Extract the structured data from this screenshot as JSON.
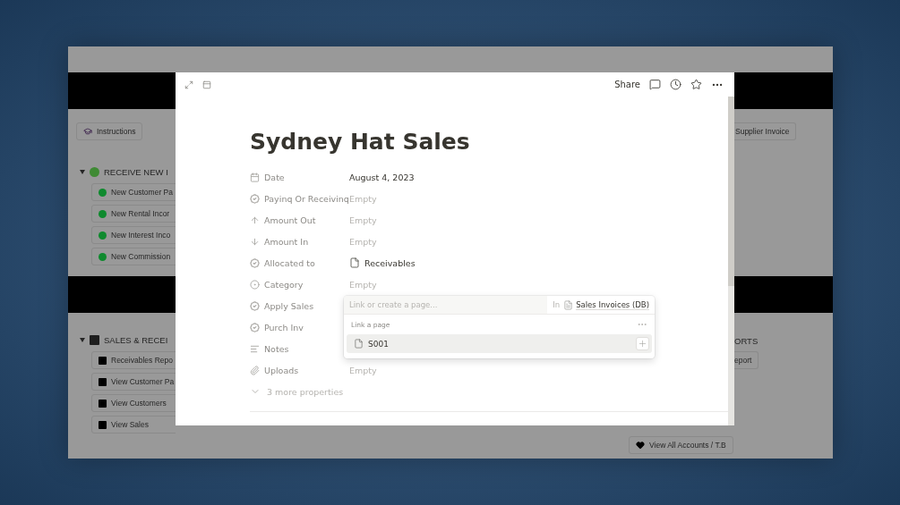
{
  "background": {
    "instructions_button": "Instructions",
    "left_sections": [
      {
        "title": "RECEIVE NEW I",
        "color": "#3f8a34",
        "buttons": [
          {
            "label": "New Customer Pa"
          },
          {
            "label": "New Rental Incor"
          },
          {
            "label": "New Interest Inco"
          },
          {
            "label": "New Commission"
          }
        ]
      },
      {
        "title": "SALES & RECEI",
        "color": "#1e1e1e",
        "buttons": [
          {
            "label": "Receivables Repo"
          },
          {
            "label": "View Customer Pa"
          },
          {
            "label": "View Customers"
          },
          {
            "label": "View Sales"
          }
        ]
      }
    ],
    "right_top_button": "Supplier Invoice",
    "right_heading": "ORTS",
    "right_button": "eport",
    "bottom_button": "View All Accounts / T.B"
  },
  "modal": {
    "toolbar": {
      "share": "Share"
    },
    "title": "Sydney Hat Sales",
    "properties": [
      {
        "kind": "date",
        "label": "Date",
        "value": "August 4, 2023",
        "empty": false,
        "editing": false
      },
      {
        "kind": "relation",
        "label": "Payinq Or Receivinq",
        "value": "Empty",
        "empty": true,
        "editing": false
      },
      {
        "kind": "number-out",
        "label": "Amount Out",
        "value": "Empty",
        "empty": true,
        "editing": false
      },
      {
        "kind": "number-in",
        "label": "Amount In",
        "value": "Empty",
        "empty": true,
        "editing": false
      },
      {
        "kind": "relation",
        "label": "Allocated to",
        "value": "Receivables",
        "empty": false,
        "editing": false
      },
      {
        "kind": "select",
        "label": "Category",
        "value": "Empty",
        "empty": true,
        "editing": false
      },
      {
        "kind": "relation",
        "label": "Apply Sales",
        "editing": true
      },
      {
        "kind": "relation",
        "label": "Purch Inv",
        "editing": false
      },
      {
        "kind": "text",
        "label": "Notes",
        "editing": false
      },
      {
        "kind": "files",
        "label": "Uploads",
        "value": "Empty",
        "empty": true,
        "editing": false
      }
    ],
    "more_properties": "3 more properties",
    "popup": {
      "placeholder": "Link or create a page...",
      "in_label": "In",
      "database": "Sales Invoices (DB)",
      "section": "Link a page",
      "results": [
        {
          "label": "S001",
          "selected": true
        }
      ]
    }
  }
}
